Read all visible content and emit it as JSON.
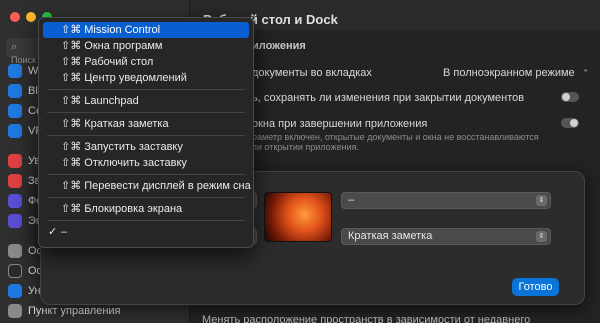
{
  "window": {
    "title": "Рабочий стол и Dock"
  },
  "sidebar": {
    "search_placeholder": "Поиск",
    "items": [
      {
        "label": "Wi-",
        "icon": "wifi-icon",
        "color": "#1f7ae0"
      },
      {
        "label": "Blu",
        "icon": "bluetooth-icon",
        "color": "#1f7ae0"
      },
      {
        "label": "Сет",
        "icon": "network-icon",
        "color": "#1f7ae0"
      },
      {
        "label": "VPN",
        "icon": "vpn-icon",
        "color": "#1f7ae0"
      },
      {
        "label": "Уве",
        "icon": "notifications-icon",
        "color": "#e04141"
      },
      {
        "label": "Звук",
        "icon": "sound-icon",
        "color": "#e04141"
      },
      {
        "label": "Фок",
        "icon": "focus-icon",
        "color": "#5a4fd6"
      },
      {
        "label": "Экр",
        "icon": "screen-time-icon",
        "color": "#5a4fd6"
      },
      {
        "label": "Осн",
        "icon": "general-icon",
        "color": "#8a8a8a"
      },
      {
        "label": "Офо",
        "icon": "appearance-icon",
        "color": "#2a2a2a"
      },
      {
        "label": "Уни",
        "icon": "accessibility-icon",
        "color": "#1f7ae0"
      },
      {
        "label": "Пункт управления",
        "icon": "control-center-icon",
        "color": "#8a8a8a"
      }
    ]
  },
  "settings": {
    "section_heading": "иложения",
    "tabs_label": "документы во вкладках",
    "tabs_value": "В полноэкранном режиме",
    "ask_save_label": "ь, сохранять ли изменения при закрытии документов",
    "close_windows_label": "окна при завершении приложения",
    "close_windows_sub1": "раметр включен, открытые документы и окна не восстанавливаются",
    "close_windows_sub2": "пи открытии приложения.",
    "bottom_label": "Менять расположение пространств в зависимости от недавнего"
  },
  "sheet": {
    "top_select": "–",
    "bottom_select": "Краткая заметка",
    "done_label": "Готово"
  },
  "menu": {
    "items": [
      {
        "label": "⇧⌘ Mission Control",
        "selected": true
      },
      {
        "label": "⇧⌘ Окна программ"
      },
      {
        "label": "⇧⌘ Рабочий стол"
      },
      {
        "label": "⇧⌘ Центр уведомлений"
      },
      {
        "label": "⇧⌘ Launchpad"
      },
      {
        "label": "⇧⌘ Краткая заметка"
      },
      {
        "label": "⇧⌘ Запустить заставку"
      },
      {
        "label": "⇧⌘ Отключить заставку"
      },
      {
        "label": "⇧⌘ Перевести дисплей в режим сна"
      },
      {
        "label": "⇧⌘ Блокировка экрана"
      },
      {
        "label": "–",
        "checked": true,
        "check": "✓"
      }
    ]
  }
}
